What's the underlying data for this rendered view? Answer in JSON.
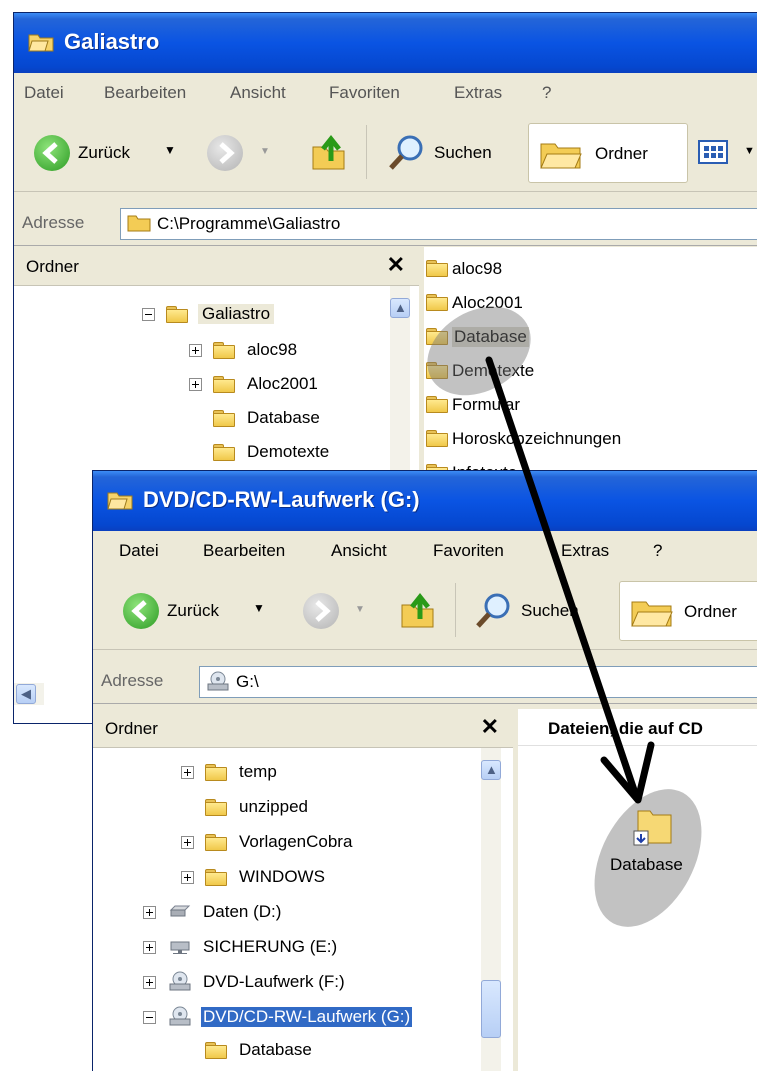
{
  "window1": {
    "title": "Galiastro",
    "menu": [
      "Datei",
      "Bearbeiten",
      "Ansicht",
      "Favoriten",
      "Extras",
      "?"
    ],
    "toolbar": {
      "back": "Zurück",
      "search": "Suchen",
      "folders": "Ordner"
    },
    "address": {
      "label": "Adresse",
      "value": "C:\\Programme\\Galiastro"
    },
    "folders_pane": {
      "title": "Ordner",
      "items": [
        "Galiastro",
        "aloc98",
        "Aloc2001",
        "Database",
        "Demotexte"
      ]
    },
    "content_items": [
      "aloc98",
      "Aloc2001",
      "Database",
      "Demotexte",
      "Formular",
      "Horoskopzeichnungen",
      "Infotexte"
    ]
  },
  "window2": {
    "title": "DVD/CD-RW-Laufwerk (G:)",
    "menu": [
      "Datei",
      "Bearbeiten",
      "Ansicht",
      "Favoriten",
      "Extras",
      "?"
    ],
    "toolbar": {
      "back": "Zurück",
      "search": "Suchen",
      "folders": "Ordner"
    },
    "address": {
      "label": "Adresse",
      "value": "G:\\"
    },
    "folders_pane": {
      "title": "Ordner",
      "items": [
        "temp",
        "unzipped",
        "VorlagenCobra",
        "WINDOWS",
        "Daten (D:)",
        "SICHERUNG (E:)",
        "DVD-Laufwerk (F:)",
        "DVD/CD-RW-Laufwerk (G:)",
        "Database"
      ]
    },
    "content_heading": "Dateien, die auf CD",
    "content_item": "Database"
  },
  "colors": {
    "titlebar": "#0a54e3",
    "selection": "#316ac5",
    "arrow": "#000000"
  }
}
